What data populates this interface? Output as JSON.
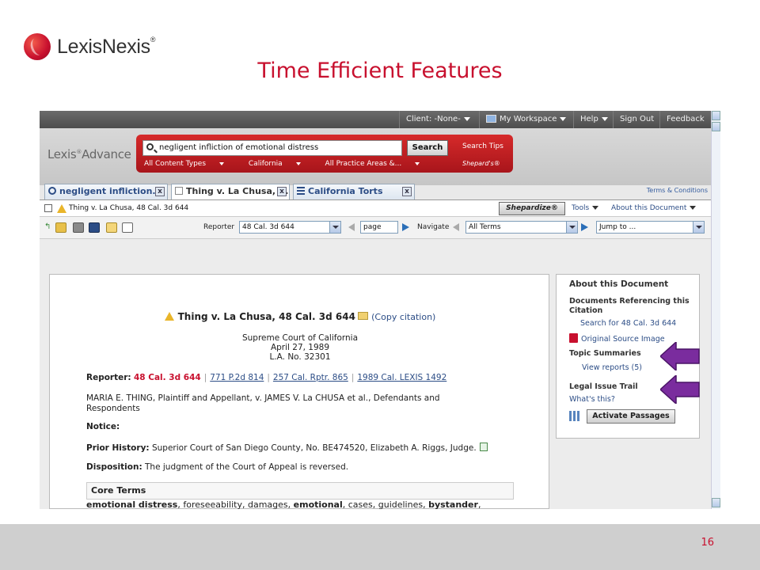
{
  "logo": {
    "text": "LexisNexis",
    "reg": "®"
  },
  "slide_title": "Time Efficient Features",
  "topbar": {
    "client": "Client: -None-",
    "workspace": "My Workspace",
    "help": "Help",
    "signout": "Sign Out",
    "feedback": "Feedback"
  },
  "header": {
    "brand": "Lexis",
    "brand_suffix": "Advance",
    "search_value": "negligent infliction of emotional distress",
    "search_button": "Search",
    "search_tips": "Search Tips",
    "shepards": "Shepard's®",
    "filters": [
      "All Content Types",
      "California",
      "All Practice Areas &..."
    ],
    "terms": "Terms & Conditions"
  },
  "tabs": [
    {
      "label": "negligent infliction...",
      "close": "x"
    },
    {
      "label": "Thing v. La Chusa, ...",
      "close": "x"
    },
    {
      "label": "California Torts",
      "close": "x"
    }
  ],
  "docbar": {
    "title": "Thing v. La Chusa, 48 Cal. 3d 644",
    "shepardize": "Shepardize®",
    "tools": "Tools",
    "about": "About this Document"
  },
  "toolbar": {
    "reporter_label": "Reporter",
    "reporter_value": "48 Cal. 3d 644",
    "page_value": "page",
    "navigate_label": "Navigate",
    "navigate_value": "All Terms",
    "jump_value": "Jump to ..."
  },
  "document": {
    "case_title": "Thing v. La Chusa, 48 Cal. 3d 644",
    "copy_citation": "(Copy citation)",
    "court": "Supreme Court of California",
    "date": "April 27, 1989",
    "docket": "L.A. No. 32301",
    "reporter_label": "Reporter:",
    "reporter_main": "48 Cal. 3d 644",
    "parallel_cites": [
      "771 P.2d 814",
      "257 Cal. Rptr. 865",
      "1989 Cal. LEXIS 1492"
    ],
    "parties_line1": "MARIA E. THING, Plaintiff and Appellant, v. JAMES V. La CHUSA et al., Defendants and",
    "parties_line2": "Respondents",
    "notice_label": "Notice:",
    "prior_label": "Prior History:",
    "prior_text": "Superior Court of San Diego County, No. BE474520, Elizabeth A. Riggs, Judge.",
    "disposition_label": "Disposition:",
    "disposition_text": "The judgment of the Court of Appeal is reversed.",
    "core_terms_label": "Core Terms",
    "core_terms": [
      {
        "t": "emotional distress",
        "b": true
      },
      {
        "t": ", foreseeability, damages, ",
        "b": false
      },
      {
        "t": "emotional",
        "b": true
      },
      {
        "t": ", cases, guidelines, ",
        "b": false
      },
      {
        "t": "bystander",
        "b": true
      },
      {
        "t": ",",
        "b": false
      }
    ]
  },
  "sidebar": {
    "about": "About this Document",
    "docs_ref_1": "Documents Referencing this",
    "docs_ref_2": "Citation",
    "search_for": "Search for 48 Cal. 3d 644",
    "original_source": "Original Source Image",
    "topic_summaries": "Topic Summaries",
    "view_reports": "View reports (5)",
    "legal_issue": "Legal Issue Trail",
    "whats_this": "What's this?",
    "activate": "Activate Passages"
  },
  "colors": {
    "brand_red": "#c8102e",
    "link_blue": "#2c4d86",
    "arrow_purple": "#7a2c9e"
  },
  "page_number": "16"
}
